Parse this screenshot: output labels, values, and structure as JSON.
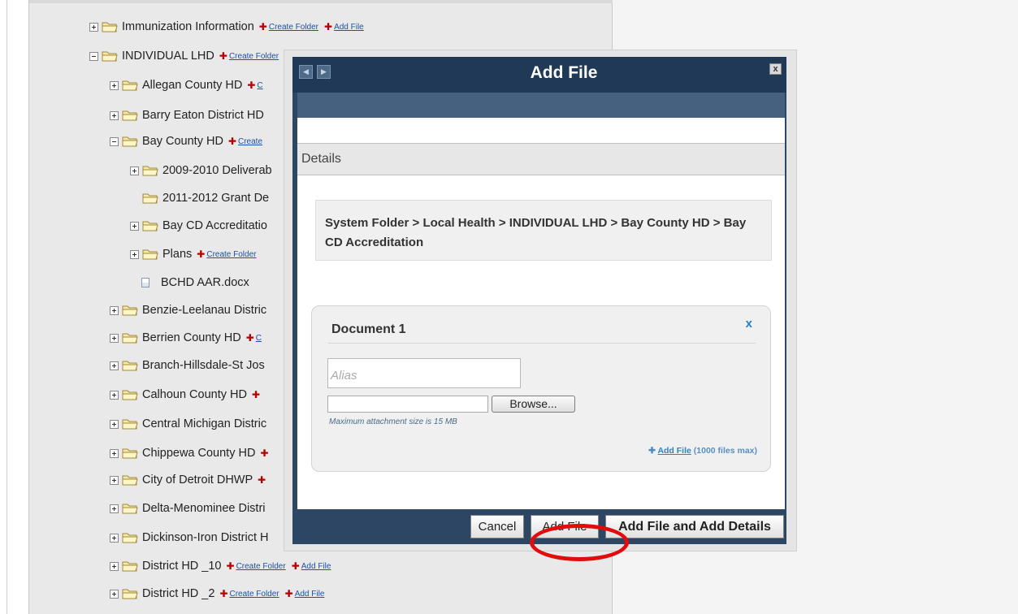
{
  "tree": {
    "items": [
      {
        "label": "Immunization Information",
        "create": "Create Folder",
        "add": "Add File"
      },
      {
        "label": "INDIVIDUAL LHD",
        "create": "Create Folder"
      },
      {
        "label": "Allegan County HD",
        "create": "C"
      },
      {
        "label": "Barry Eaton District HD"
      },
      {
        "label": "Bay County HD",
        "create": "Create"
      },
      {
        "label": "2009-2010 Deliverab"
      },
      {
        "label": "2011-2012 Grant De"
      },
      {
        "label": "Bay CD Accreditatio"
      },
      {
        "label": "Plans",
        "create": "Create Folder"
      },
      {
        "label": "BCHD AAR.docx"
      },
      {
        "label": "Benzie-Leelanau Distric"
      },
      {
        "label": "Berrien County HD",
        "create": "C"
      },
      {
        "label": "Branch-Hillsdale-St Jos"
      },
      {
        "label": "Calhoun County HD"
      },
      {
        "label": "Central Michigan Distric"
      },
      {
        "label": "Chippewa County HD"
      },
      {
        "label": "City of Detroit DHWP"
      },
      {
        "label": "Delta-Menominee Distri"
      },
      {
        "label": "Dickinson-Iron District H"
      },
      {
        "label": "District HD _10",
        "create": "Create Folder",
        "add": "Add File"
      },
      {
        "label": "District HD _2",
        "create": "Create Folder",
        "add": "Add File"
      }
    ]
  },
  "modal": {
    "title": "Add File",
    "close": "x",
    "details_heading": "Details",
    "path": "System Folder > Local Health > INDIVIDUAL LHD > Bay County HD > Bay CD Accreditation",
    "document": {
      "title": "Document 1",
      "remove": "x",
      "alias_placeholder": "Alias",
      "browse": "Browse...",
      "max_size": "Maximum attachment size is 15 MB",
      "add_file_link": "Add File",
      "add_file_limit": "(1000 files max)"
    },
    "buttons": {
      "cancel": "Cancel",
      "add_file": "Add File",
      "add_file_details": "Add File and Add Details"
    }
  },
  "colors": {
    "modal_header": "#1f3957",
    "modal_body": "#2d4664",
    "link": "#1f4fa8",
    "highlight_circle": "#e10d0d"
  }
}
